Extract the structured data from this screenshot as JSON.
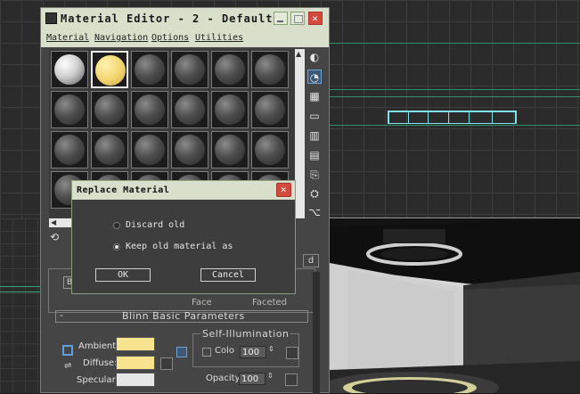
{
  "material_editor": {
    "title": "Material Editor - 2 - Default",
    "menu": [
      "Material",
      "Navigation",
      "Options",
      "Utilities"
    ],
    "rollout_title": "Blinn Basic Parameters",
    "self_illumination": {
      "label": "Self-Illumination",
      "color_label": "Colo",
      "color_value": "100"
    },
    "params": {
      "ambient_label": "Ambient:",
      "diffuse_label": "Diffuse:",
      "specular_label": "Specular:",
      "opacity_label": "Opacity:",
      "opacity_value": "100"
    },
    "colors": {
      "ambient": "#f8e38e",
      "diffuse": "#f8e38e",
      "specular": "#e6e6e6"
    },
    "partial_labels": {
      "faceted": "Faceted",
      "face": "Face",
      "button_tail": "d",
      "b_label": "B"
    }
  },
  "dialog": {
    "title": "Replace Material",
    "option_discard": "Discard old",
    "option_keep": "Keep old material as",
    "selected": "Keep old material as",
    "ok_label": "OK",
    "cancel_label": "Cancel"
  }
}
